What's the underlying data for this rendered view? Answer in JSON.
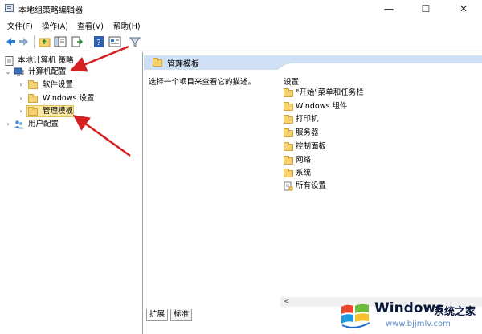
{
  "window": {
    "title": "本地组策略编辑器",
    "minimize": "—",
    "maximize": "☐",
    "close": "✕"
  },
  "menu": [
    "文件(F)",
    "操作(A)",
    "查看(V)",
    "帮助(H)"
  ],
  "tree": {
    "root": "本地计算机 策略",
    "computer_config": "计算机配置",
    "software_settings": "软件设置",
    "windows_settings": "Windows 设置",
    "admin_templates": "管理模板",
    "user_config": "用户配置"
  },
  "right": {
    "header": "管理模板",
    "description": "选择一个项目来查看它的描述。",
    "column_header": "设置",
    "items": [
      "\"开始\"菜单和任务栏",
      "Windows 组件",
      "打印机",
      "服务器",
      "控制面板",
      "网络",
      "系统",
      "所有设置"
    ]
  },
  "tabs": [
    "扩展",
    "标准"
  ],
  "scroll": {
    "left": "<",
    "right": ">"
  },
  "watermark": {
    "brand": "Windows",
    "brand_cn": "系统之家",
    "url": "www.bjjmlv.com"
  },
  "colors": {
    "header_band": "#cfe0f5",
    "selected": "#fbe8a6",
    "arrow": "#d42020",
    "folder": "#f6d36e"
  }
}
